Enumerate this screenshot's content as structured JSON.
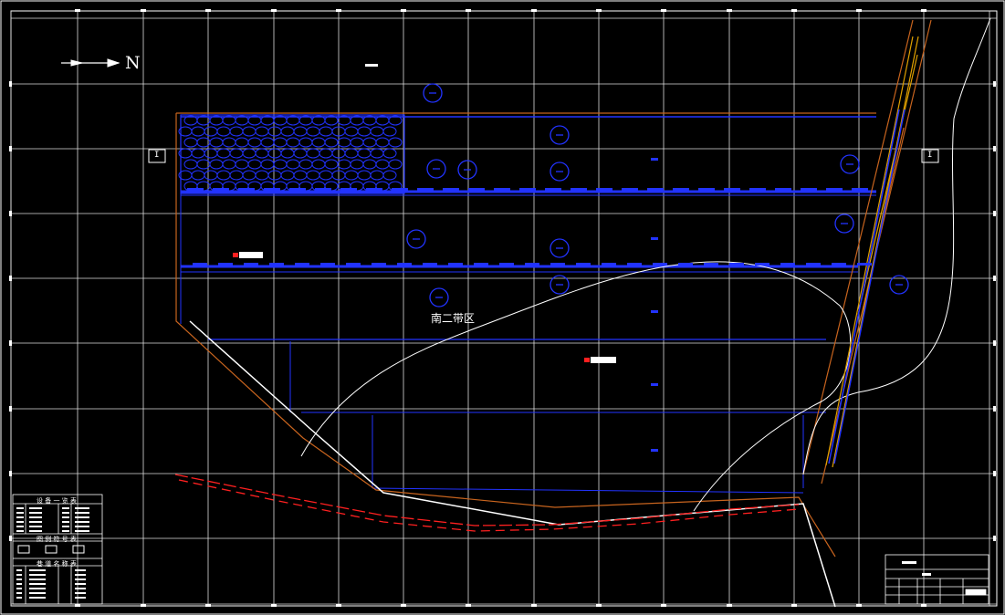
{
  "drawing": {
    "north_label": "N",
    "zone_label": "南二带区",
    "section_marks": [
      "I",
      "I"
    ],
    "colors": {
      "background": "#000000",
      "grid": "#ffffff",
      "roadway": "#1f2fff",
      "boundary": "#c8641e",
      "river": "#ff2020",
      "contour": "#ffffff",
      "conveyor": "#e0a000"
    },
    "legend_tables": {
      "equipment_title": "设 备 一 览 表",
      "legend_title": "图 例 符 号 表",
      "notes_title": "巷 道 名 称 表"
    }
  }
}
